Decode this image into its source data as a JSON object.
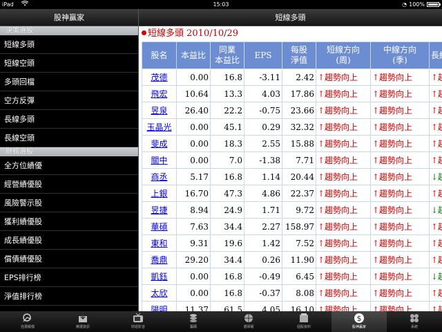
{
  "status": {
    "device": "iPad",
    "time": "15:03",
    "battery": "100%",
    "battery_level": 1.0
  },
  "left_panel": {
    "title": "股神贏家",
    "sections": [
      {
        "header": "決策選股",
        "items": [
          "短線多頭",
          "短線空頭",
          "多頭回檔",
          "空方反彈",
          "長線多頭",
          "長線空頭"
        ]
      },
      {
        "header": "財務選股",
        "items": [
          "全方位績優",
          "經營績優股",
          "風險警示股",
          "獲利績優股",
          "成長績優股",
          "償債績優股",
          "EPS排行榜",
          "淨值排行榜"
        ]
      }
    ]
  },
  "right_panel": {
    "title": "短線多頭",
    "list_title": "短線多頭 2010/10/29",
    "columns": [
      "股名",
      "本益比",
      "同業\n本益比",
      "EPS",
      "每股\n淨值",
      "短線方向\n(周)",
      "中線方向\n(季)",
      "長線"
    ],
    "rows": [
      {
        "name": "茂德",
        "pe": "0.00",
        "ind_pe": "16.8",
        "eps": "-3.11",
        "nav": "2.42",
        "short": "↑趨勢向上",
        "mid": "↑趨勢向上",
        "long": "↑趨勢",
        "long_dir": "up"
      },
      {
        "name": "飛宏",
        "pe": "10.64",
        "ind_pe": "13.3",
        "eps": "4.03",
        "nav": "17.86",
        "short": "↑趨勢向上",
        "mid": "↑趨勢向上",
        "long": "↑趨勢",
        "long_dir": "up"
      },
      {
        "name": "昱泉",
        "pe": "26.40",
        "ind_pe": "22.2",
        "eps": "-0.75",
        "nav": "23.66",
        "short": "↑趨勢向上",
        "mid": "↑趨勢向上",
        "long": "↑趨勢",
        "long_dir": "up"
      },
      {
        "name": "玉晶光",
        "pe": "0.00",
        "ind_pe": "45.1",
        "eps": "0.29",
        "nav": "32.32",
        "short": "↑趨勢向上",
        "mid": "↑趨勢向上",
        "long": "↑趨勢",
        "long_dir": "up"
      },
      {
        "name": "斐成",
        "pe": "0.00",
        "ind_pe": "18.3",
        "eps": "2.55",
        "nav": "15.88",
        "short": "↑趨勢向上",
        "mid": "↑趨勢向上",
        "long": "↑趨勢",
        "long_dir": "up"
      },
      {
        "name": "關中",
        "pe": "0.00",
        "ind_pe": "7.0",
        "eps": "-1.38",
        "nav": "7.71",
        "short": "↑趨勢向上",
        "mid": "↑趨勢向上",
        "long": "↑趨勢",
        "long_dir": "up"
      },
      {
        "name": "商丞",
        "pe": "5.17",
        "ind_pe": "16.8",
        "eps": "1.14",
        "nav": "20.44",
        "short": "↑趨勢向上",
        "mid": "↑趨勢向上",
        "long": "↓趨勢",
        "long_dir": "down"
      },
      {
        "name": "上銀",
        "pe": "16.70",
        "ind_pe": "47.3",
        "eps": "4.86",
        "nav": "22.37",
        "short": "↑趨勢向上",
        "mid": "↑趨勢向上",
        "long": "↑趨勢",
        "long_dir": "up"
      },
      {
        "name": "昱捷",
        "pe": "8.94",
        "ind_pe": "24.9",
        "eps": "1.71",
        "nav": "9.72",
        "short": "↑趨勢向上",
        "mid": "↑趨勢向上",
        "long": "↓趨勢",
        "long_dir": "down"
      },
      {
        "name": "華碩",
        "pe": "7.63",
        "ind_pe": "34.4",
        "eps": "2.27",
        "nav": "158.97",
        "short": "↑趨勢向上",
        "mid": "↑趨勢向上",
        "long": "↑趨勢",
        "long_dir": "up"
      },
      {
        "name": "東和",
        "pe": "9.31",
        "ind_pe": "19.6",
        "eps": "1.42",
        "nav": "7.52",
        "short": "↑趨勢向上",
        "mid": "↑趨勢向上",
        "long": "↑趨勢",
        "long_dir": "up"
      },
      {
        "name": "喬鼎",
        "pe": "29.20",
        "ind_pe": "34.4",
        "eps": "0.26",
        "nav": "11.90",
        "short": "↑趨勢向上",
        "mid": "↑趨勢向上",
        "long": "↑趨勢",
        "long_dir": "up"
      },
      {
        "name": "凱鈺",
        "pe": "0.00",
        "ind_pe": "16.8",
        "eps": "-0.49",
        "nav": "6.45",
        "short": "↑趨勢向上",
        "mid": "↑趨勢向上",
        "long": "↓趨勢",
        "long_dir": "down"
      },
      {
        "name": "太欣",
        "pe": "0.00",
        "ind_pe": "16.8",
        "eps": "-0.37",
        "nav": "8.08",
        "short": "↑趨勢向上",
        "mid": "↑趨勢向上",
        "long": "↑趨勢",
        "long_dir": "up"
      },
      {
        "name": "陽明",
        "pe": "11.37",
        "ind_pe": "61.5",
        "eps": "4.05",
        "nav": "16.10",
        "short": "↑趨勢向上",
        "mid": "↑趨勢向上",
        "long": "↑趨勢",
        "long_dir": "up"
      }
    ]
  },
  "tabbar": {
    "items": [
      {
        "label": "自選報價",
        "icon": "quote-icon"
      },
      {
        "label": "精選資訊",
        "icon": "inbox-icon"
      },
      {
        "label": "財經影音",
        "icon": "tv-icon"
      },
      {
        "label": "籌碼",
        "icon": "coins-icon"
      },
      {
        "label": "選擇權",
        "icon": "globe-icon"
      },
      {
        "label": "個股資料",
        "icon": "folder-icon"
      },
      {
        "label": "股神贏家",
        "icon": "dollar-icon"
      },
      {
        "label": "系統",
        "icon": "settings-icon"
      }
    ],
    "active_index": 6
  }
}
